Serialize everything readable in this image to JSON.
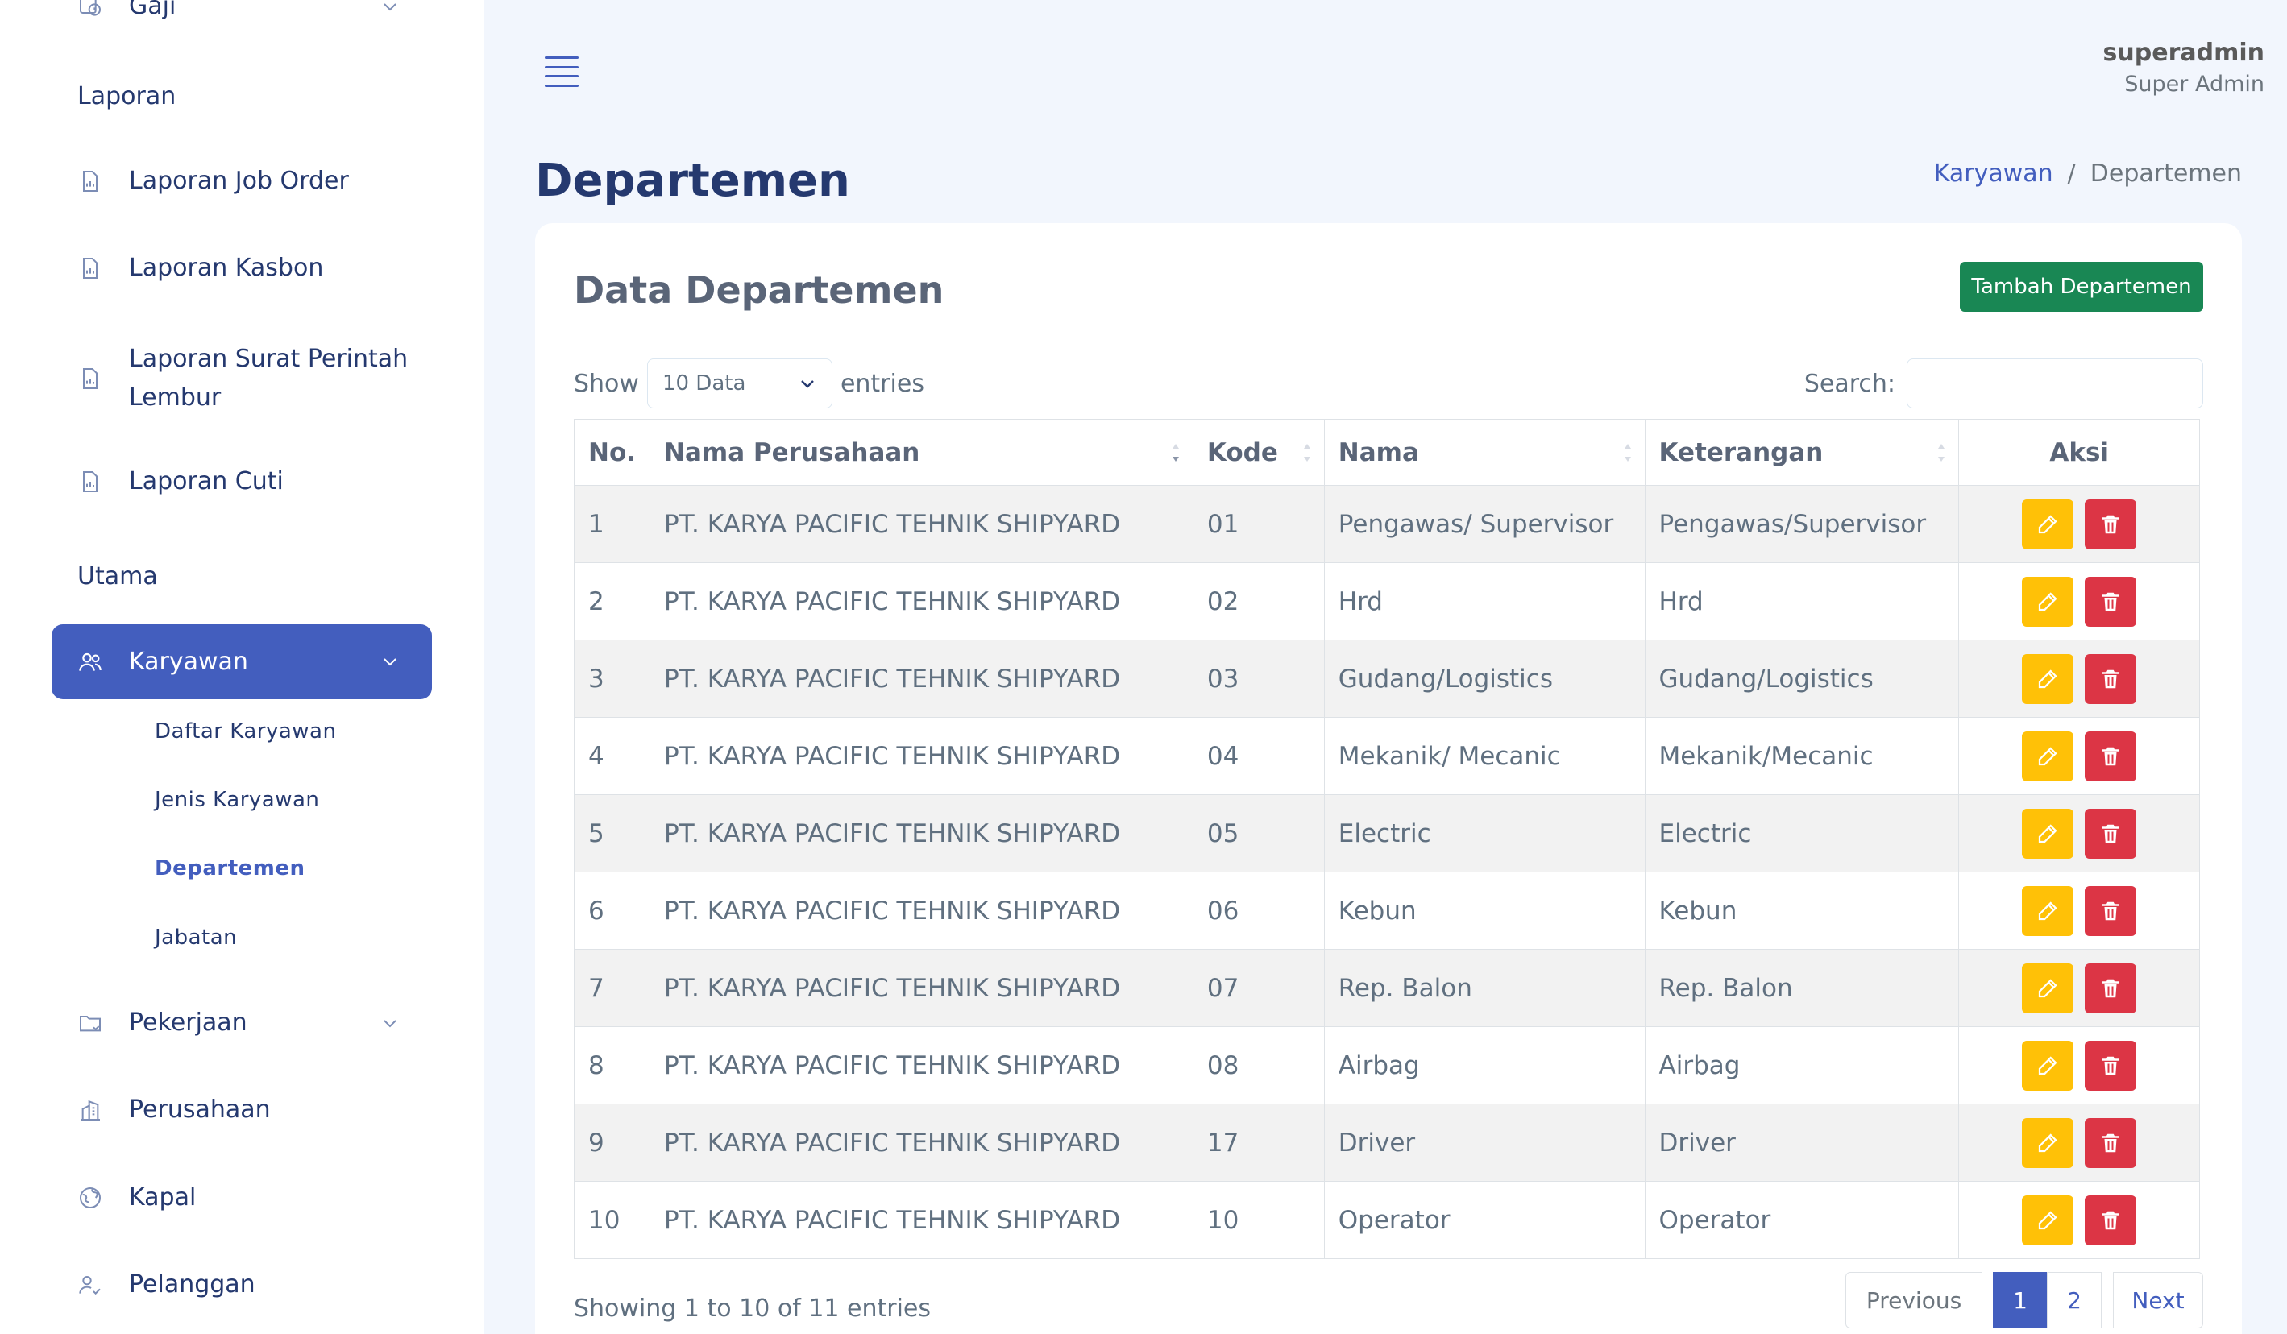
{
  "sidebar": {
    "gaji_label": "Gaji",
    "section_laporan": "Laporan",
    "laporan_items": [
      {
        "label": "Laporan Job Order",
        "icon": "report-icon"
      },
      {
        "label": "Laporan Kasbon",
        "icon": "report-icon"
      },
      {
        "label": "Laporan Surat Perintah",
        "label2": "Lembur",
        "icon": "report-icon"
      },
      {
        "label": "Laporan Cuti",
        "icon": "report-icon"
      }
    ],
    "section_utama": "Utama",
    "karyawan_label": "Karyawan",
    "karyawan_sub": [
      "Daftar Karyawan",
      "Jenis Karyawan",
      "Departemen",
      "Jabatan"
    ],
    "pekerjaan_label": "Pekerjaan",
    "perusahaan_label": "Perusahaan",
    "kapal_label": "Kapal",
    "pelanggan_label": "Pelanggan"
  },
  "header": {
    "username": "superadmin",
    "role": "Super Admin"
  },
  "page": {
    "title": "Departemen",
    "breadcrumb": [
      "Karyawan",
      "/",
      "Departemen"
    ]
  },
  "card": {
    "title": "Data Departemen",
    "add_button": "Tambah Departemen",
    "show_label": "Show",
    "show_value": "10 Data",
    "entries_label": "entries",
    "search_label": "Search:",
    "search_value": "",
    "columns": [
      "No.",
      "Nama Perusahaan",
      "Kode",
      "Nama",
      "Keterangan",
      "Aksi"
    ],
    "rows": [
      [
        "1",
        "PT. KARYA PACIFIC TEHNIK SHIPYARD",
        "01",
        "Pengawas/ Supervisor",
        "Pengawas/Supervisor"
      ],
      [
        "2",
        "PT. KARYA PACIFIC TEHNIK SHIPYARD",
        "02",
        "Hrd",
        "Hrd"
      ],
      [
        "3",
        "PT. KARYA PACIFIC TEHNIK SHIPYARD",
        "03",
        "Gudang/Logistics",
        "Gudang/Logistics"
      ],
      [
        "4",
        "PT. KARYA PACIFIC TEHNIK SHIPYARD",
        "04",
        "Mekanik/ Mecanic",
        "Mekanik/Mecanic"
      ],
      [
        "5",
        "PT. KARYA PACIFIC TEHNIK SHIPYARD",
        "05",
        "Electric",
        "Electric"
      ],
      [
        "6",
        "PT. KARYA PACIFIC TEHNIK SHIPYARD",
        "06",
        "Kebun",
        "Kebun"
      ],
      [
        "7",
        "PT. KARYA PACIFIC TEHNIK SHIPYARD",
        "07",
        "Rep. Balon",
        "Rep. Balon"
      ],
      [
        "8",
        "PT. KARYA PACIFIC TEHNIK SHIPYARD",
        "08",
        "Airbag",
        "Airbag"
      ],
      [
        "9",
        "PT. KARYA PACIFIC TEHNIK SHIPYARD",
        "17",
        "Driver",
        "Driver"
      ],
      [
        "10",
        "PT. KARYA PACIFIC TEHNIK SHIPYARD",
        "10",
        "Operator",
        "Operator"
      ]
    ],
    "info": "Showing 1 to 10 of 11 entries",
    "pagination": {
      "previous": "Previous",
      "pages": [
        "1",
        "2"
      ],
      "next": "Next"
    }
  },
  "colors": {
    "primary": "#435ebe",
    "success": "#198754",
    "warning": "#ffc107",
    "danger": "#dc3545",
    "bg": "#f2f6fd"
  }
}
